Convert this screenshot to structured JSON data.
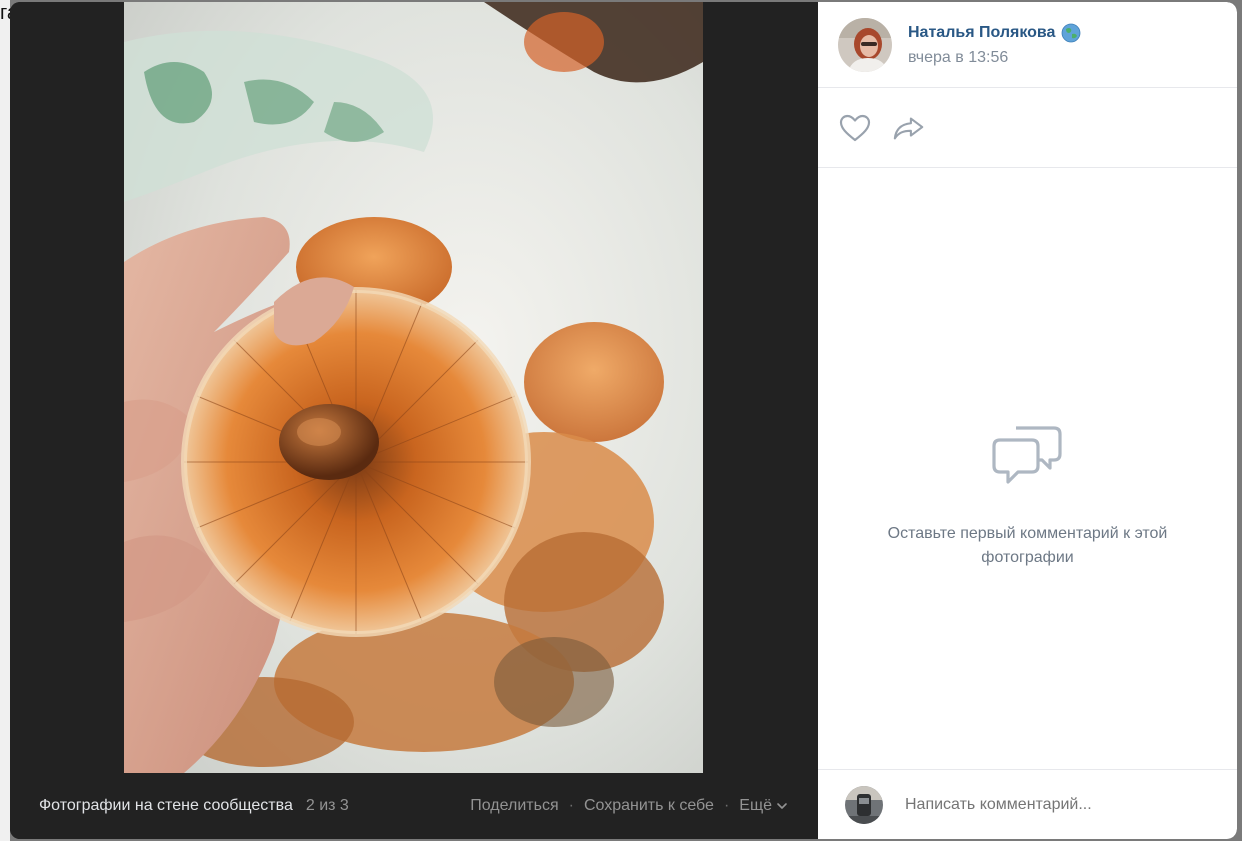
{
  "backdrop": {
    "fragment": "га"
  },
  "viewer": {
    "photo_footer": {
      "album_title": "Фотографии на стене сообщества",
      "counter": "2 из 3",
      "share_label": "Поделиться",
      "save_label": "Сохранить к себе",
      "more_label": "Ещё",
      "separator": "·"
    },
    "author": {
      "name": "Наталья Полякова",
      "time": "вчера в 13:56",
      "badge_icon": "globe-icon"
    },
    "actions": {
      "like_icon": "heart-icon",
      "share_icon": "share-arrow-icon"
    },
    "comments": {
      "empty_icon": "comments-icon",
      "empty_text": "Оставьте первый комментарий к этой фотографии"
    },
    "composer": {
      "placeholder": "Написать комментарий..."
    }
  },
  "colors": {
    "viewer_bg": "#222222",
    "link": "#2a5885",
    "muted": "#818c99"
  }
}
